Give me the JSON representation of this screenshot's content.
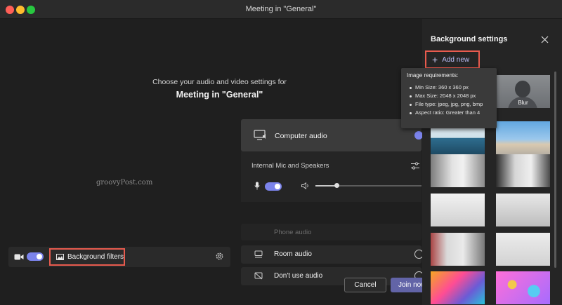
{
  "window": {
    "title": "Meeting in \"General\""
  },
  "prejoin": {
    "choose_label": "Choose your audio and video settings for",
    "meeting_name": "Meeting in \"General\"",
    "watermark": "groovyPost.com"
  },
  "video_bar": {
    "camera_on": true,
    "background_filters_label": "Background filters"
  },
  "audio": {
    "computer_audio_label": "Computer audio",
    "device_label": "Internal Mic and Speakers",
    "mic_on": true,
    "volume_fraction": 0.2,
    "phone_audio_label": "Phone audio",
    "room_audio_label": "Room audio",
    "no_audio_label": "Don't use audio"
  },
  "actions": {
    "cancel_label": "Cancel",
    "join_label": "Join now"
  },
  "background_panel": {
    "title": "Background settings",
    "add_new_label": "Add new",
    "blur_label": "Blur"
  },
  "tooltip": {
    "title": "Image requirements:",
    "items": [
      "Min Size: 360 x 360 px",
      "Max Size: 2048 x 2048 px",
      "File type: jpeg, jpg, png, bmp",
      "Aspect ratio: Greater than 4"
    ]
  },
  "colors": {
    "accent": "#6264a7",
    "toggle": "#7b83eb",
    "highlight_box": "#e85b4e"
  }
}
